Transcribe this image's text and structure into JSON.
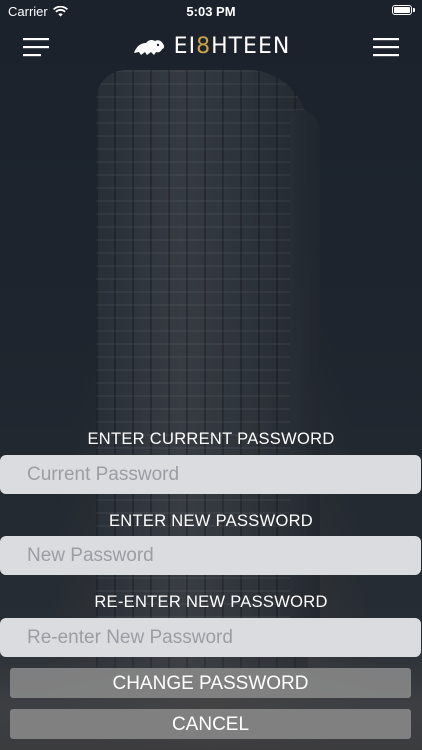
{
  "status_bar": {
    "carrier": "Carrier",
    "time": "5:03 PM"
  },
  "navbar": {
    "logo_prefix": "EI",
    "logo_accent": "8",
    "logo_suffix": "HTEEN",
    "left_icon": "menu-icon",
    "right_icon": "menu-icon"
  },
  "form": {
    "current_label": "ENTER CURRENT PASSWORD",
    "current_placeholder": "Current Password",
    "current_value": "",
    "new_label": "ENTER NEW PASSWORD",
    "new_placeholder": "New Password",
    "new_value": "",
    "reenter_label": "RE-ENTER NEW PASSWORD",
    "reenter_placeholder": "Re-enter New Password",
    "reenter_value": ""
  },
  "actions": {
    "change_label": "CHANGE PASSWORD",
    "cancel_label": "CANCEL"
  },
  "colors": {
    "accent": "#c9a24a",
    "field_bg": "#dadcdf",
    "button_bg": "#8c8c8c"
  }
}
